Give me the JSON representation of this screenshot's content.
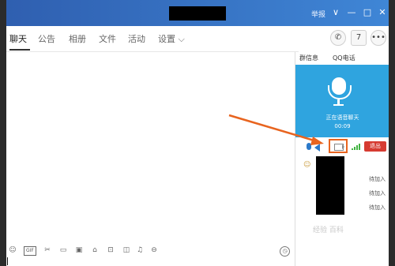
{
  "titlebar": {
    "label": "举报",
    "controls": [
      "∨",
      "—",
      "□",
      "✕"
    ]
  },
  "tabs": [
    {
      "label": "聊天"
    },
    {
      "label": "公告"
    },
    {
      "label": "相册"
    },
    {
      "label": "文件"
    },
    {
      "label": "活动"
    },
    {
      "label": "设置 ⌵"
    }
  ],
  "header_icons": {
    "call": "phone-icon",
    "calendar_day": "7",
    "more": "•••"
  },
  "side": {
    "tabs": [
      "群信息",
      "QQ电话"
    ],
    "call": {
      "status": "正在语音聊天",
      "duration": "00:09"
    },
    "exit_label": "退出",
    "members": [
      {
        "status": "待加入"
      },
      {
        "status": "待加入"
      },
      {
        "status": "待加入"
      }
    ],
    "watermark": "经验 百科"
  },
  "toolbar": {
    "gif_label": "GIF",
    "icons": [
      "smile-icon",
      "gif-icon",
      "scissors-icon",
      "folder-icon",
      "image-icon",
      "shop-icon",
      "gift-icon",
      "bell-icon",
      "more-icon",
      "history-icon"
    ]
  },
  "colors": {
    "titlebar": "#3f86d6",
    "call_panel": "#2fa4df",
    "exit": "#d63b31",
    "highlight": "#e8641f",
    "signal": "#41b341"
  }
}
